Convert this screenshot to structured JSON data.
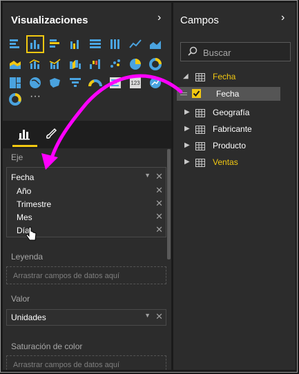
{
  "visualizations": {
    "title": "Visualizaciones",
    "more_label": "···",
    "wells": {
      "axis": {
        "label": "Eje",
        "field": "Fecha",
        "subfields": [
          "Año",
          "Trimestre",
          "Mes",
          "Día"
        ]
      },
      "legend": {
        "label": "Leyenda",
        "placeholder": "Arrastrar campos de datos aquí"
      },
      "value": {
        "label": "Valor",
        "field": "Unidades"
      },
      "color_saturation": {
        "label": "Saturación de color",
        "placeholder": "Arrastrar campos de datos aquí"
      }
    }
  },
  "fields": {
    "title": "Campos",
    "search_placeholder": "Buscar",
    "tables": [
      {
        "name": "Fecha",
        "expanded": true,
        "color": "#f2c811"
      },
      {
        "name": "Fecha",
        "child": true,
        "checked": true
      },
      {
        "name": "Geografía",
        "color": "#ffffff"
      },
      {
        "name": "Fabricante",
        "color": "#ffffff"
      },
      {
        "name": "Producto",
        "color": "#ffffff"
      },
      {
        "name": "Ventas",
        "color": "#f2c811"
      }
    ]
  },
  "colors": {
    "accent": "#f2c811",
    "drag_arrow": "#ff00ff",
    "panel_bg": "#2c2c2c"
  }
}
